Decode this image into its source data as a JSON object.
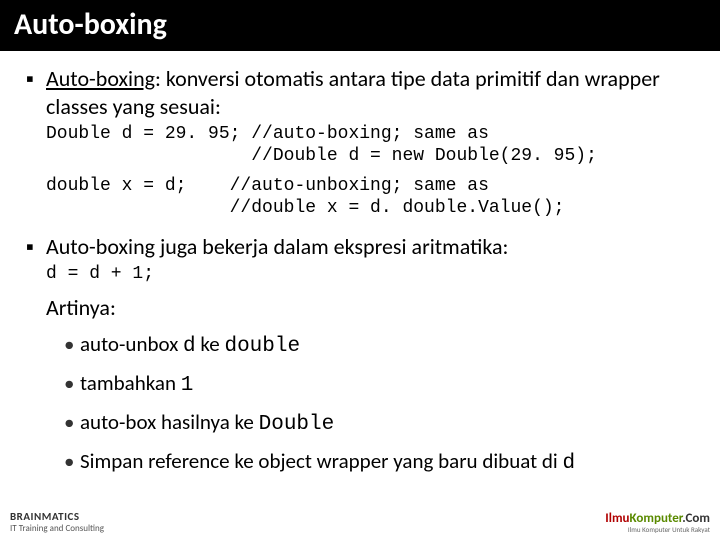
{
  "title": "Auto-boxing",
  "bullets": {
    "b1": {
      "termA": "Auto-boxing",
      "rest": ": konversi otomatis antara tipe data primitif dan wrapper classes yang sesuai:"
    },
    "code1": "Double d = 29. 95; //auto-boxing; same as\n                   //Double d = new Double(29. 95);",
    "code2": "double x = d;    //auto-unboxing; same as\n                 //double x = d. double.Value();",
    "b2": "Auto-boxing juga bekerja dalam ekspresi aritmatika:",
    "code3": "d = d + 1;",
    "artinya": "Artinya:",
    "s1a": "auto-unbox ",
    "s1b": "d",
    "s1c": " ke ",
    "s1d": "double",
    "s2a": "tambahkan ",
    "s2b": "1",
    "s3a": "auto-box hasilnya ke ",
    "s3b": "Double",
    "s4a": "Simpan reference ke object wrapper yang baru dibuat di ",
    "s4b": "d"
  },
  "footer": {
    "left1": "BRAINMATICS",
    "left2": "IT Training and Consulting",
    "right1": "Ilmu",
    "right2": "Komputer",
    "right3": ".Com",
    "right4": "Ilmu Komputer Untuk Rakyat"
  }
}
